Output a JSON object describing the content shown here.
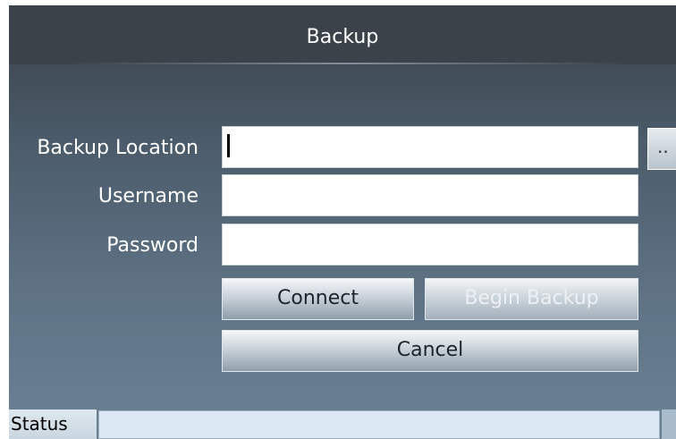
{
  "window": {
    "title": "Backup"
  },
  "form": {
    "backup_location": {
      "label": "Backup Location",
      "value": "",
      "browse_label": ".."
    },
    "username": {
      "label": "Username",
      "value": ""
    },
    "password": {
      "label": "Password",
      "value": ""
    }
  },
  "buttons": {
    "connect": "Connect",
    "begin_backup": "Begin Backup",
    "cancel": "Cancel"
  },
  "status": {
    "label": "Status",
    "text": ""
  }
}
